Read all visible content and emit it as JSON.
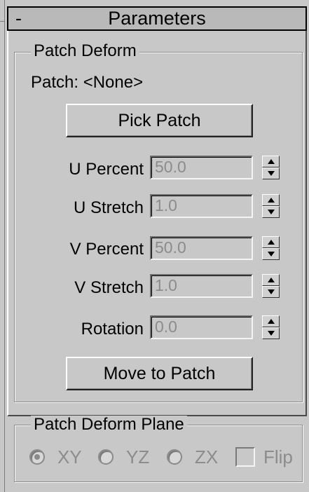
{
  "rollout": {
    "toggle": "-",
    "title": "Parameters"
  },
  "patch_deform": {
    "group_title": "Patch Deform",
    "patch_label": "Patch: <None>",
    "pick_button": "Pick Patch",
    "fields": [
      {
        "label": "U Percent",
        "value": "50.0"
      },
      {
        "label": "U Stretch",
        "value": "1.0"
      },
      {
        "label": "V Percent",
        "value": "50.0"
      },
      {
        "label": "V Stretch",
        "value": "1.0"
      },
      {
        "label": "Rotation",
        "value": "0.0"
      }
    ],
    "move_button": "Move to Patch"
  },
  "plane": {
    "group_title": "Patch Deform Plane",
    "options": [
      {
        "label": "XY",
        "selected": true
      },
      {
        "label": "YZ",
        "selected": false
      },
      {
        "label": "ZX",
        "selected": false
      }
    ],
    "flip_label": "Flip",
    "flip_checked": false,
    "enabled": false
  }
}
